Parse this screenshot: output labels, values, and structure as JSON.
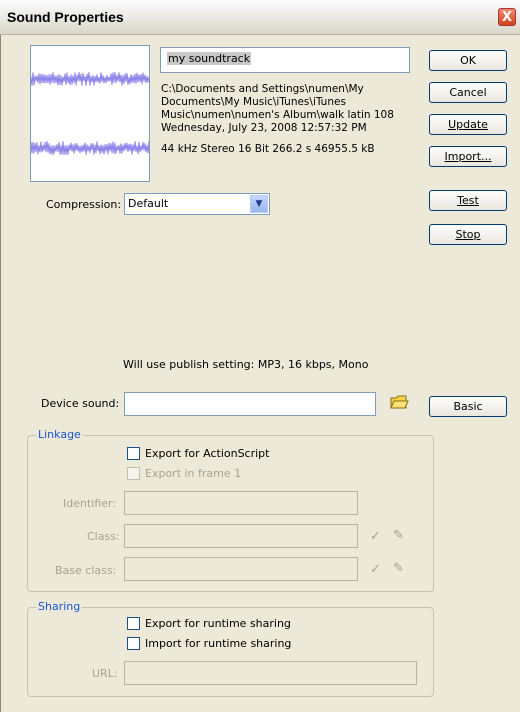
{
  "window": {
    "title": "Sound Properties",
    "close_glyph": "X"
  },
  "sound": {
    "name": "my soundtrack",
    "path_line1": "C:\\Documents and Settings\\numen\\My",
    "path_line2": "Documents\\My Music\\iTunes\\iTunes",
    "path_line3": "Music\\numen\\numen's Album\\walk latin 108",
    "date": "Wednesday, July 23, 2008  12:57:32 PM",
    "format": "44 kHz Stereo 16 Bit 266.2 s 46955.5 kB"
  },
  "buttons": {
    "ok": "OK",
    "cancel": "Cancel",
    "update": "Update",
    "import": "Import...",
    "test": "Test",
    "stop": "Stop",
    "basic": "Basic"
  },
  "compression": {
    "label": "Compression:",
    "value": "Default"
  },
  "publish_note": "Will use publish setting: MP3, 16 kbps, Mono",
  "device_sound": {
    "label": "Device sound:",
    "value": ""
  },
  "linkage": {
    "title": "Linkage",
    "export_actionscript": "Export for ActionScript",
    "export_frame1": "Export in frame 1",
    "identifier_label": "Identifier:",
    "class_label": "Class:",
    "base_class_label": "Base class:"
  },
  "sharing": {
    "title": "Sharing",
    "export_runtime": "Export for runtime sharing",
    "import_runtime": "Import for runtime sharing",
    "url_label": "URL:"
  },
  "icons": {
    "folder": "folder-icon",
    "check": "checkmark-icon",
    "pencil": "pencil-icon"
  }
}
